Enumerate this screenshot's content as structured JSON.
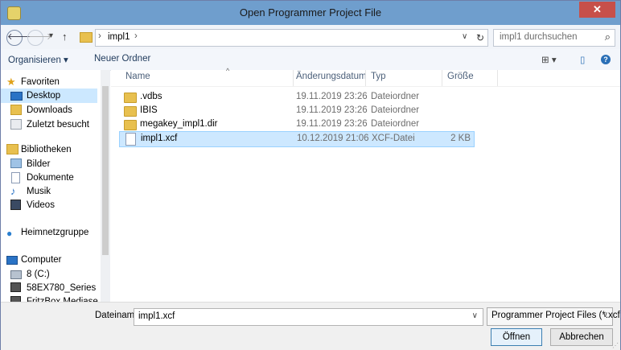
{
  "window": {
    "title": "Open Programmer Project File",
    "close_glyph": "✕"
  },
  "address": {
    "back_glyph": "🡐",
    "forward_glyph": "🡒",
    "dropdown_glyph": "▾",
    "up_glyph": "↑",
    "sep_glyph": "›",
    "crumb": "impl1",
    "crumb_sep": "›",
    "caret": "∨",
    "refresh_glyph": "↻",
    "search_placeholder": "impl1 durchsuchen",
    "search_icon": "⌕"
  },
  "toolbar": {
    "organize": "Organisieren ▾",
    "new_folder": "Neuer Ordner",
    "view_glyph": "⊞ ▾",
    "pane_glyph": "▯",
    "help_glyph": "?"
  },
  "sidebar": {
    "favorites": "Favoriten",
    "desktop": "Desktop",
    "downloads": "Downloads",
    "recent": "Zuletzt besucht",
    "libraries": "Bibliotheken",
    "pictures": "Bilder",
    "documents": "Dokumente",
    "music": "Musik",
    "videos": "Videos",
    "homegroup": "Heimnetzgruppe",
    "computer": "Computer",
    "drive_c": "8 (C:)",
    "printer1": "58EX780_Series",
    "printer2": "FritzBox Mediase"
  },
  "columns": {
    "name": "Name",
    "date": "Änderungsdatum",
    "type": "Typ",
    "size": "Größe"
  },
  "files": [
    {
      "name": ".vdbs",
      "date": "19.11.2019 23:26",
      "type": "Dateiordner",
      "size": "",
      "icon": "folder"
    },
    {
      "name": "IBIS",
      "date": "19.11.2019 23:26",
      "type": "Dateiordner",
      "size": "",
      "icon": "folder"
    },
    {
      "name": "megakey_impl1.dir",
      "date": "19.11.2019 23:26",
      "type": "Dateiordner",
      "size": "",
      "icon": "folder"
    },
    {
      "name": "impl1.xcf",
      "date": "10.12.2019 21:06",
      "type": "XCF-Datei",
      "size": "2 KB",
      "icon": "file"
    }
  ],
  "footer": {
    "filename_label": "Dateiname:",
    "filename_value": "impl1.xcf",
    "filename_caret": "∨",
    "filter": "Programmer Project Files (*.xcf",
    "filter_caret": "∨",
    "open": "Öffnen",
    "cancel": "Abbrechen"
  },
  "colors": {
    "titlebar": "#6f9ecd",
    "close": "#c7504a",
    "selection": "#cde8ff"
  }
}
